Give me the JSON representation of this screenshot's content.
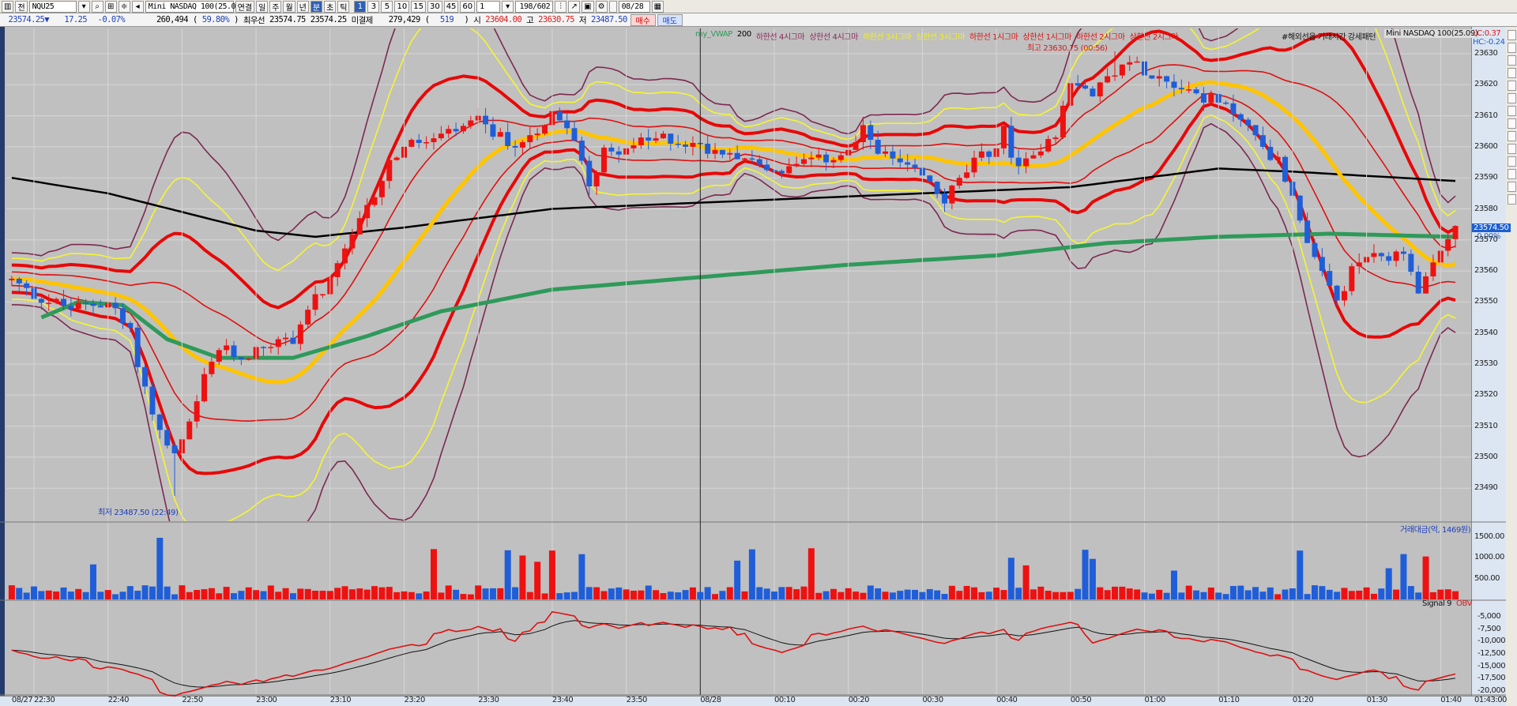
{
  "toolbar": {
    "account": "전",
    "code": "NQU25",
    "product": "Mini NASDAQ 100(25.0",
    "link_label": "연결",
    "periods": [
      "일",
      "주",
      "월",
      "년",
      "분",
      "초",
      "틱"
    ],
    "active_period": "분",
    "intervals": [
      "1",
      "3",
      "5",
      "10",
      "15",
      "30",
      "45",
      "60"
    ],
    "active_interval": "1",
    "custom_interval": "1",
    "count": "198/602",
    "date": "08/28"
  },
  "quote": {
    "price": "23574.25▼",
    "change": "17.25",
    "change_pct": "-0.07%",
    "volume": "260,494",
    "vol_ratio_open": "(",
    "vol_ratio": "59.80%",
    "vol_ratio_close": ")",
    "best_label": "최우선",
    "ask": "23574.75",
    "bid": "23574.25",
    "oi_label": "미결제",
    "oi": "279,429",
    "oi_paren_open": "(",
    "oi_change": "519",
    "oi_paren_close": ")",
    "open_label": "시",
    "open": "23604.00",
    "high_label": "고",
    "high": "23630.75",
    "low_label": "저",
    "low": "23487.50",
    "buy_label": "매수",
    "sell_label": "매도"
  },
  "legend": {
    "vwap": "my_VWAP",
    "ma": "200",
    "items": [
      {
        "label": "하한선 4시그마",
        "color": "#8a2a5a"
      },
      {
        "label": "상한선 4시그마",
        "color": "#8a2a5a"
      },
      {
        "label": "하한선 3시그마",
        "color": "#f0f020"
      },
      {
        "label": "상한선 3시그마",
        "color": "#f0f020"
      },
      {
        "label": "하한선 1시그마",
        "color": "#e01010"
      },
      {
        "label": "상한선 1시그마",
        "color": "#e01010"
      },
      {
        "label": "하한선 2시그마",
        "color": "#e01010"
      },
      {
        "label": "상한선 2시그마",
        "color": "#e01010"
      }
    ],
    "pattern": "#해외선옵 거래시간 강세패턴",
    "instrument": "Mini NASDAQ 100(25.09)",
    "lc": "LC:0.37",
    "hc": "HC:-0.24"
  },
  "annotations": {
    "high": "최고 23630.75 (00:56)",
    "low": "최저 23487.50 (22:49)",
    "last_price": "23574.50",
    "last_pct": "-0.00%"
  },
  "volume_panel": {
    "title": "거래대금(억, 1469원)",
    "ticks": [
      "1500.00",
      "1000.00",
      "500.00"
    ]
  },
  "obv_panel": {
    "signal_label": "Signal 9",
    "obv_label": "OBV",
    "ticks": [
      "-5,000",
      "-7,500",
      "-10,000",
      "-12,500",
      "-15,000",
      "-17,500",
      "-20,000"
    ]
  },
  "colors": {
    "up": "#ee1111",
    "down": "#1f5ed8",
    "vwap": "#2e9a5a",
    "ma200": "#000000",
    "mid": "#ffc400",
    "sig1": "#e01010",
    "sig2": "#e80808",
    "sig3": "#f5f530",
    "sig4": "#7d2850"
  },
  "chart_data": {
    "type": "candlestick",
    "title": "Mini NASDAQ 100(25.09) 1분",
    "price_ticks": [
      23630,
      23620,
      23610,
      23600,
      23590,
      23580,
      23570,
      23560,
      23550,
      23540,
      23530,
      23520,
      23510,
      23500,
      23490
    ],
    "time_ticks": [
      {
        "m": -3,
        "label": "08/27"
      },
      {
        "m": 0,
        "label": "22:30"
      },
      {
        "m": 10,
        "label": "22:40"
      },
      {
        "m": 20,
        "label": "22:50"
      },
      {
        "m": 30,
        "label": "23:00"
      },
      {
        "m": 40,
        "label": "23:10"
      },
      {
        "m": 50,
        "label": "23:20"
      },
      {
        "m": 60,
        "label": "23:30"
      },
      {
        "m": 70,
        "label": "23:40"
      },
      {
        "m": 80,
        "label": "23:50"
      },
      {
        "m": 90,
        "label": "08/28"
      },
      {
        "m": 100,
        "label": "00:10"
      },
      {
        "m": 110,
        "label": "00:20"
      },
      {
        "m": 120,
        "label": "00:30"
      },
      {
        "m": 130,
        "label": "00:40"
      },
      {
        "m": 140,
        "label": "00:50"
      },
      {
        "m": 150,
        "label": "01:00"
      },
      {
        "m": 160,
        "label": "01:10"
      },
      {
        "m": 170,
        "label": "01:20"
      },
      {
        "m": 180,
        "label": "01:30"
      },
      {
        "m": 190,
        "label": "01:40"
      }
    ],
    "axis_end_label": "01:43:00",
    "minutes_from_2230_range": [
      -3,
      192
    ],
    "close_waypoints": [
      [
        -3,
        23557
      ],
      [
        0,
        23552
      ],
      [
        5,
        23548
      ],
      [
        10,
        23550
      ],
      [
        13,
        23540
      ],
      [
        15,
        23522
      ],
      [
        17,
        23508
      ],
      [
        19,
        23500
      ],
      [
        21,
        23510
      ],
      [
        23,
        23525
      ],
      [
        25,
        23535
      ],
      [
        28,
        23532
      ],
      [
        31,
        23536
      ],
      [
        35,
        23538
      ],
      [
        37,
        23548
      ],
      [
        40,
        23556
      ],
      [
        42,
        23566
      ],
      [
        45,
        23580
      ],
      [
        48,
        23595
      ],
      [
        50,
        23600
      ],
      [
        55,
        23603
      ],
      [
        60,
        23608
      ],
      [
        65,
        23600
      ],
      [
        70,
        23610
      ],
      [
        73,
        23603
      ],
      [
        75,
        23589
      ],
      [
        77,
        23598
      ],
      [
        80,
        23600
      ],
      [
        85,
        23603
      ],
      [
        90,
        23600
      ],
      [
        95,
        23598
      ],
      [
        100,
        23592
      ],
      [
        105,
        23595
      ],
      [
        110,
        23598
      ],
      [
        112,
        23605
      ],
      [
        115,
        23597
      ],
      [
        120,
        23590
      ],
      [
        123,
        23583
      ],
      [
        127,
        23595
      ],
      [
        130,
        23600
      ],
      [
        131,
        23605
      ],
      [
        133,
        23592
      ],
      [
        136,
        23600
      ],
      [
        138,
        23605
      ],
      [
        140,
        23620
      ],
      [
        143,
        23618
      ],
      [
        145,
        23622
      ],
      [
        147,
        23628
      ],
      [
        150,
        23625
      ],
      [
        153,
        23622
      ],
      [
        156,
        23618
      ],
      [
        160,
        23614
      ],
      [
        163,
        23610
      ],
      [
        165,
        23603
      ],
      [
        168,
        23595
      ],
      [
        170,
        23585
      ],
      [
        172,
        23570
      ],
      [
        174,
        23558
      ],
      [
        176,
        23550
      ],
      [
        178,
        23560
      ],
      [
        180,
        23565
      ],
      [
        182,
        23563
      ],
      [
        185,
        23565
      ],
      [
        187,
        23553
      ],
      [
        188,
        23557
      ],
      [
        190,
        23565
      ],
      [
        192,
        23574.5
      ]
    ],
    "ma200_waypoints": [
      [
        -3,
        23590
      ],
      [
        10,
        23585
      ],
      [
        20,
        23579
      ],
      [
        30,
        23573
      ],
      [
        38,
        23571
      ],
      [
        50,
        23574
      ],
      [
        70,
        23580
      ],
      [
        90,
        23582
      ],
      [
        120,
        23585
      ],
      [
        140,
        23587
      ],
      [
        160,
        23593
      ],
      [
        170,
        23592
      ],
      [
        192,
        23589
      ]
    ],
    "vwap_waypoints": [
      [
        1,
        23545
      ],
      [
        6,
        23550
      ],
      [
        12,
        23549
      ],
      [
        18,
        23538
      ],
      [
        25,
        23532
      ],
      [
        35,
        23532
      ],
      [
        45,
        23539
      ],
      [
        55,
        23547
      ],
      [
        70,
        23554
      ],
      [
        90,
        23558
      ],
      [
        110,
        23562
      ],
      [
        130,
        23565
      ],
      [
        145,
        23569
      ],
      [
        160,
        23571
      ],
      [
        175,
        23572
      ],
      [
        192,
        23571
      ]
    ],
    "session_low": 23487.5,
    "session_high": 23630.75
  }
}
